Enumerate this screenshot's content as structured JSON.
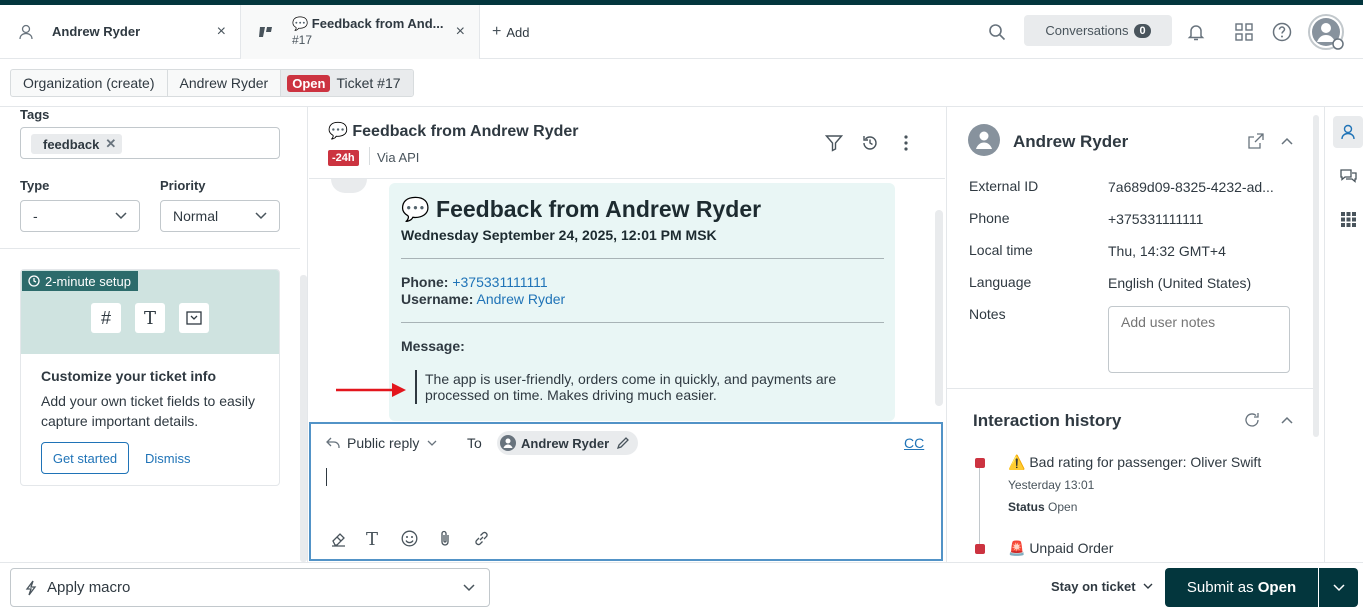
{
  "tabs": [
    {
      "label": "Andrew Ryder"
    },
    {
      "label_line1": "💬 Feedback from And...",
      "label_line2": "#17"
    }
  ],
  "add_tab_label": "Add",
  "header": {
    "conversations_label": "Conversations",
    "conversations_count": "0"
  },
  "breadcrumbs": {
    "org": "Organization (create)",
    "user": "Andrew Ryder",
    "status_badge": "Open",
    "ticket": "Ticket #17"
  },
  "left_panel": {
    "tags_label": "Tags",
    "tag": "feedback",
    "type_label": "Type",
    "type_value": "-",
    "priority_label": "Priority",
    "priority_value": "Normal",
    "setup_badge": "2-minute setup",
    "promo_title": "Customize your ticket info",
    "promo_text": "Add your own ticket fields to easily capture important details.",
    "get_started": "Get started",
    "dismiss": "Dismiss"
  },
  "ticket": {
    "title": "💬 Feedback from Andrew Ryder",
    "sla_badge": "-24h",
    "via": "Via API",
    "message": {
      "heading": "💬 Feedback from Andrew Ryder",
      "date": "Wednesday September 24, 2025, 12:01 PM MSK",
      "phone_label": "Phone:",
      "phone": "+375331111111",
      "username_label": "Username:",
      "username": "Andrew Ryder",
      "message_label": "Message:",
      "body": "The app is user-friendly, orders come in quickly, and payments are processed on time. Makes driving much easier."
    }
  },
  "composer": {
    "reply_type": "Public reply",
    "to_label": "To",
    "recipient": "Andrew Ryder",
    "cc": "CC"
  },
  "user_panel": {
    "name": "Andrew Ryder",
    "external_id_label": "External ID",
    "external_id": "7a689d09-8325-4232-ad...",
    "phone_label": "Phone",
    "phone": "+375331111111",
    "local_time_label": "Local time",
    "local_time": "Thu, 14:32 GMT+4",
    "language_label": "Language",
    "language": "English (United States)",
    "notes_label": "Notes",
    "notes_placeholder": "Add user notes"
  },
  "history": {
    "title": "Interaction history",
    "items": [
      {
        "title": "⚠️ Bad rating for passenger: Oliver Swift",
        "time": "Yesterday 13:01",
        "status_label": "Status",
        "status": "Open"
      },
      {
        "title": "🚨 Unpaid Order"
      }
    ]
  },
  "bottom": {
    "macro": "Apply macro",
    "stay": "Stay on ticket",
    "submit_prefix": "Submit as",
    "submit_status": "Open"
  },
  "colors": {
    "accent": "#1f73b7",
    "dark": "#03363d",
    "danger": "#cc3340",
    "message_bg": "#e9f6f5",
    "promo_bg": "#cfe3e0"
  }
}
